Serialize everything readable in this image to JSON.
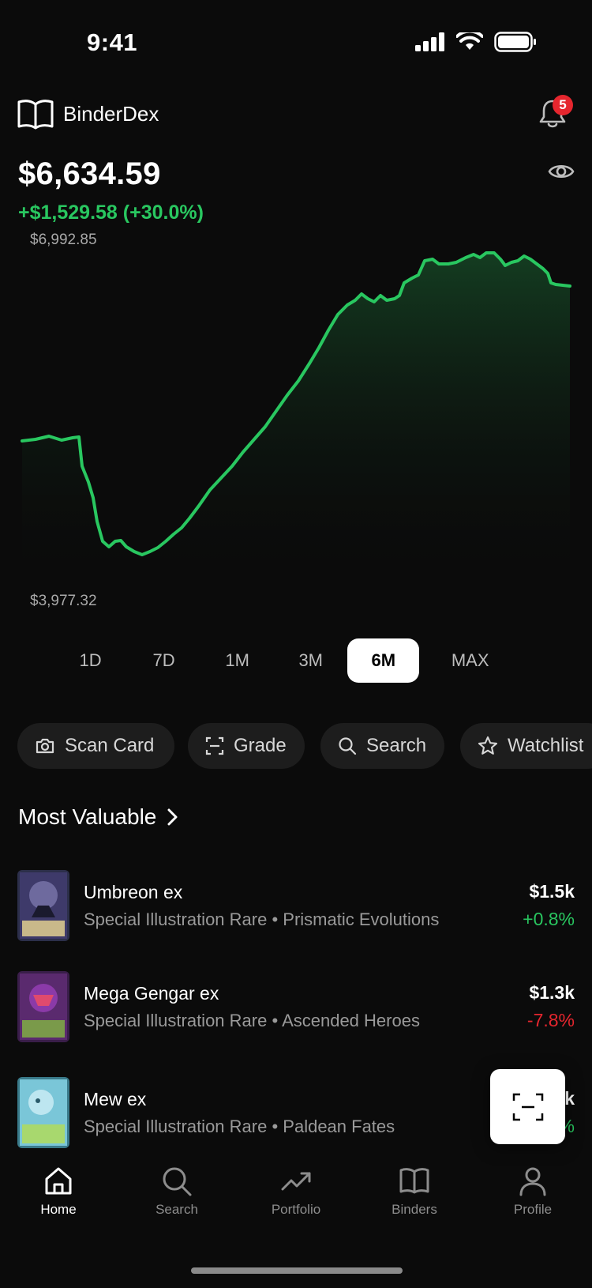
{
  "status": {
    "time": "9:41"
  },
  "header": {
    "app_name": "BinderDex",
    "notification_count": "5"
  },
  "portfolio": {
    "value": "$6,634.59",
    "change": "+$1,529.58 (+30.0%)",
    "chart_max_label": "$6,992.85",
    "chart_min_label": "$3,977.32"
  },
  "ranges": {
    "items": [
      "1D",
      "7D",
      "1M",
      "3M",
      "6M",
      "MAX"
    ],
    "selected": "6M"
  },
  "actions": {
    "scan": "Scan Card",
    "grade": "Grade",
    "search": "Search",
    "watchlist": "Watchlist"
  },
  "section": {
    "title": "Most Valuable"
  },
  "cards": [
    {
      "name": "Umbreon ex",
      "rarity": "Special Illustration Rare",
      "set": "Prismatic Evolutions",
      "price": "$1.5k",
      "change": "+0.8%",
      "trend": "up"
    },
    {
      "name": "Mega Gengar ex",
      "rarity": "Special Illustration Rare",
      "set": "Ascended Heroes",
      "price": "$1.3k",
      "change": "-7.8%",
      "trend": "down"
    },
    {
      "name": "Mew ex",
      "rarity": "Special Illustration Rare",
      "set": "Paldean Fates",
      "price": "$1.k",
      "change": "%",
      "trend": "up"
    }
  ],
  "tabs": {
    "home": "Home",
    "search": "Search",
    "portfolio": "Portfolio",
    "binders": "Binders",
    "profile": "Profile"
  },
  "colors": {
    "accent_green": "#29c760",
    "negative_red": "#e5262e",
    "background": "#0b0b0b",
    "chip_background": "#1d1d1d"
  }
}
